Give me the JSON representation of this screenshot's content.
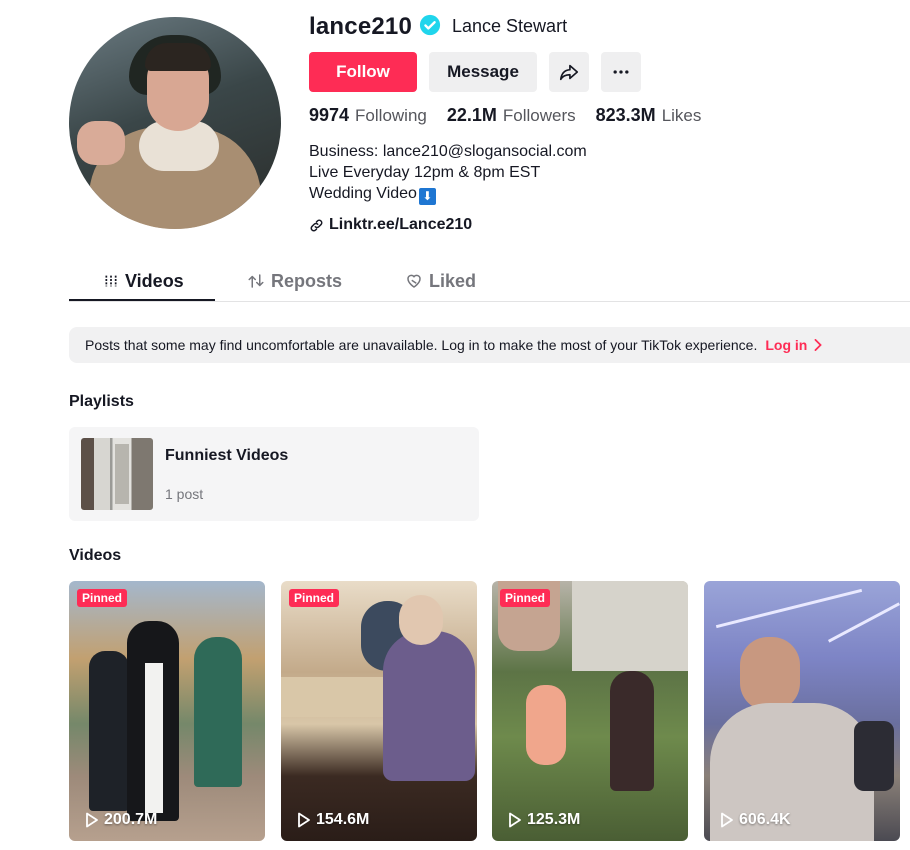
{
  "profile": {
    "username": "lance210",
    "nickname": "Lance Stewart",
    "verified": true,
    "follow_label": "Follow",
    "message_label": "Message",
    "icons": {
      "verified": "verified-badge-icon",
      "share": "share-arrow-icon",
      "more": "more-dots-icon",
      "link": "link-chain-icon"
    }
  },
  "stats": {
    "following_count": "9974",
    "following_label": "Following",
    "followers_count": "22.1M",
    "followers_label": "Followers",
    "likes_count": "823.3M",
    "likes_label": "Likes"
  },
  "bio": {
    "line1": "Business: lance210@slogansocial.com",
    "line2": "Live Everyday 12pm & 8pm EST",
    "line3": "Wedding Video",
    "line3_emoji": "⬇",
    "link": "Linktr.ee/Lance210"
  },
  "tabs": [
    {
      "label": "Videos",
      "active": true,
      "icon": "grid-bars-icon"
    },
    {
      "label": "Reposts",
      "active": false,
      "icon": "repost-icon"
    },
    {
      "label": "Liked",
      "active": false,
      "icon": "heart-broken-icon"
    }
  ],
  "notice": {
    "text": "Posts that some may find uncomfortable are unavailable. Log in to make the most of your TikTok experience.",
    "login_label": "Log in"
  },
  "playlists": {
    "title": "Playlists",
    "items": [
      {
        "name": "Funniest Videos",
        "count": "1 post"
      }
    ]
  },
  "videos": {
    "title": "Videos",
    "items": [
      {
        "views": "200.7M",
        "pinned": true,
        "pinned_label": "Pinned"
      },
      {
        "views": "154.6M",
        "pinned": true,
        "pinned_label": "Pinned"
      },
      {
        "views": "125.3M",
        "pinned": true,
        "pinned_label": "Pinned"
      },
      {
        "views": "606.4K",
        "pinned": false,
        "pinned_label": ""
      }
    ]
  },
  "colors": {
    "accent": "#fe2c55",
    "verified": "#20d5ec",
    "text": "#161823",
    "muted": "#75767c"
  }
}
